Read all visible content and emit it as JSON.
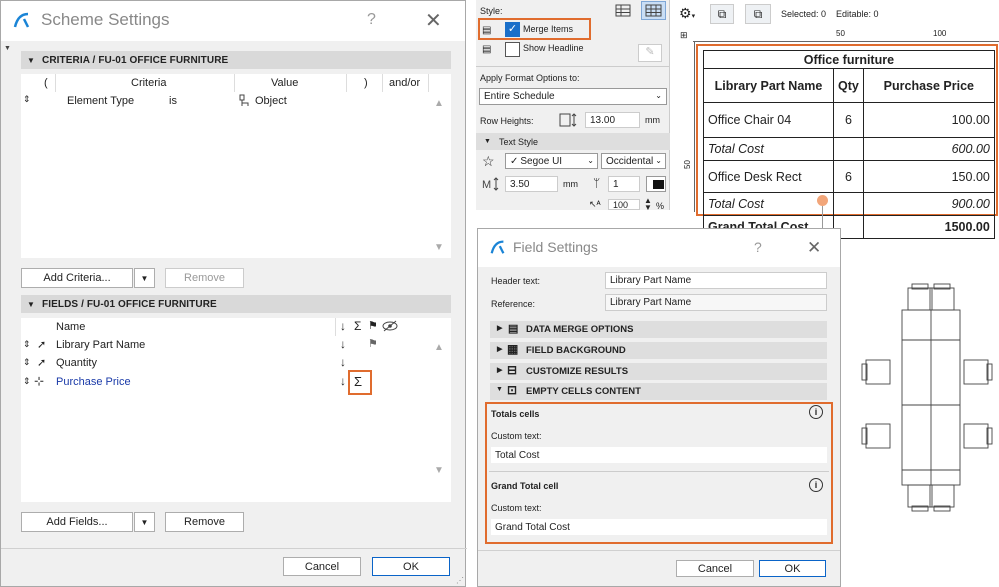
{
  "scheme": {
    "title": "Scheme Settings",
    "help": "?",
    "criteria_header": "CRITERIA / FU-01 OFFICE FURNITURE",
    "criteria_cols": [
      "(",
      "Criteria",
      "Value",
      ")",
      "and/or"
    ],
    "criteria_row": {
      "criteria": "Element Type",
      "op": "is",
      "value": "Object"
    },
    "add_criteria": "Add Criteria...",
    "remove": "Remove",
    "fields_header": "FIELDS / FU-01 OFFICE FURNITURE",
    "fields_col_name": "Name",
    "fields": [
      {
        "name": "Library Part Name"
      },
      {
        "name": "Quantity"
      },
      {
        "name": "Purchase Price"
      }
    ],
    "sigma": "Σ",
    "add_fields": "Add Fields...",
    "remove2": "Remove",
    "cancel": "Cancel",
    "ok": "OK"
  },
  "format": {
    "style_label": "Style:",
    "merge_items": "Merge Items",
    "show_headline": "Show Headline",
    "apply_label": "Apply Format Options to:",
    "apply_value": "Entire Schedule",
    "row_heights_label": "Row Heights:",
    "row_heights_value": "13.00",
    "row_unit": "mm",
    "text_style": "Text Style",
    "font": "Segoe UI",
    "script": "Occidental",
    "size": "3.50",
    "size_unit": "mm",
    "pen": "1",
    "scale": "100",
    "pct": "%"
  },
  "toolbar": {
    "selected": "Selected: 0",
    "editable": "Editable: 0"
  },
  "ruler": {
    "t50": "50",
    "t100": "100",
    "v50": "50"
  },
  "schedule": {
    "title": "Office furniture",
    "headers": [
      "Library Part Name",
      "Qty",
      "Purchase Price"
    ],
    "rows": [
      {
        "name": "Office Chair 04",
        "qty": "6",
        "price": "100.00"
      },
      {
        "name": "Total Cost",
        "qty": "",
        "price": "600.00"
      },
      {
        "name": "Office Desk Rect",
        "qty": "6",
        "price": "150.00"
      },
      {
        "name": "Total Cost",
        "qty": "",
        "price": "900.00"
      }
    ],
    "grand": {
      "name": "Grand Total Cost",
      "price": "1500.00"
    }
  },
  "field": {
    "title": "Field Settings",
    "help": "?",
    "header_text_label": "Header text:",
    "header_text_value": "Library Part Name",
    "reference_label": "Reference:",
    "reference_value": "Library Part Name",
    "sections": [
      "DATA MERGE OPTIONS",
      "FIELD BACKGROUND",
      "CUSTOMIZE RESULTS",
      "EMPTY CELLS CONTENT"
    ],
    "totals_cells": "Totals cells",
    "custom_text": "Custom text:",
    "totals_value": "Total Cost",
    "grand_cell": "Grand Total cell",
    "custom_text2": "Custom text:",
    "grand_value": "Grand Total Cost",
    "cancel": "Cancel",
    "ok": "OK"
  },
  "colors": {
    "highlight": "#e06c2e",
    "accent": "#0a64c8",
    "link": "#1a3aa8"
  }
}
